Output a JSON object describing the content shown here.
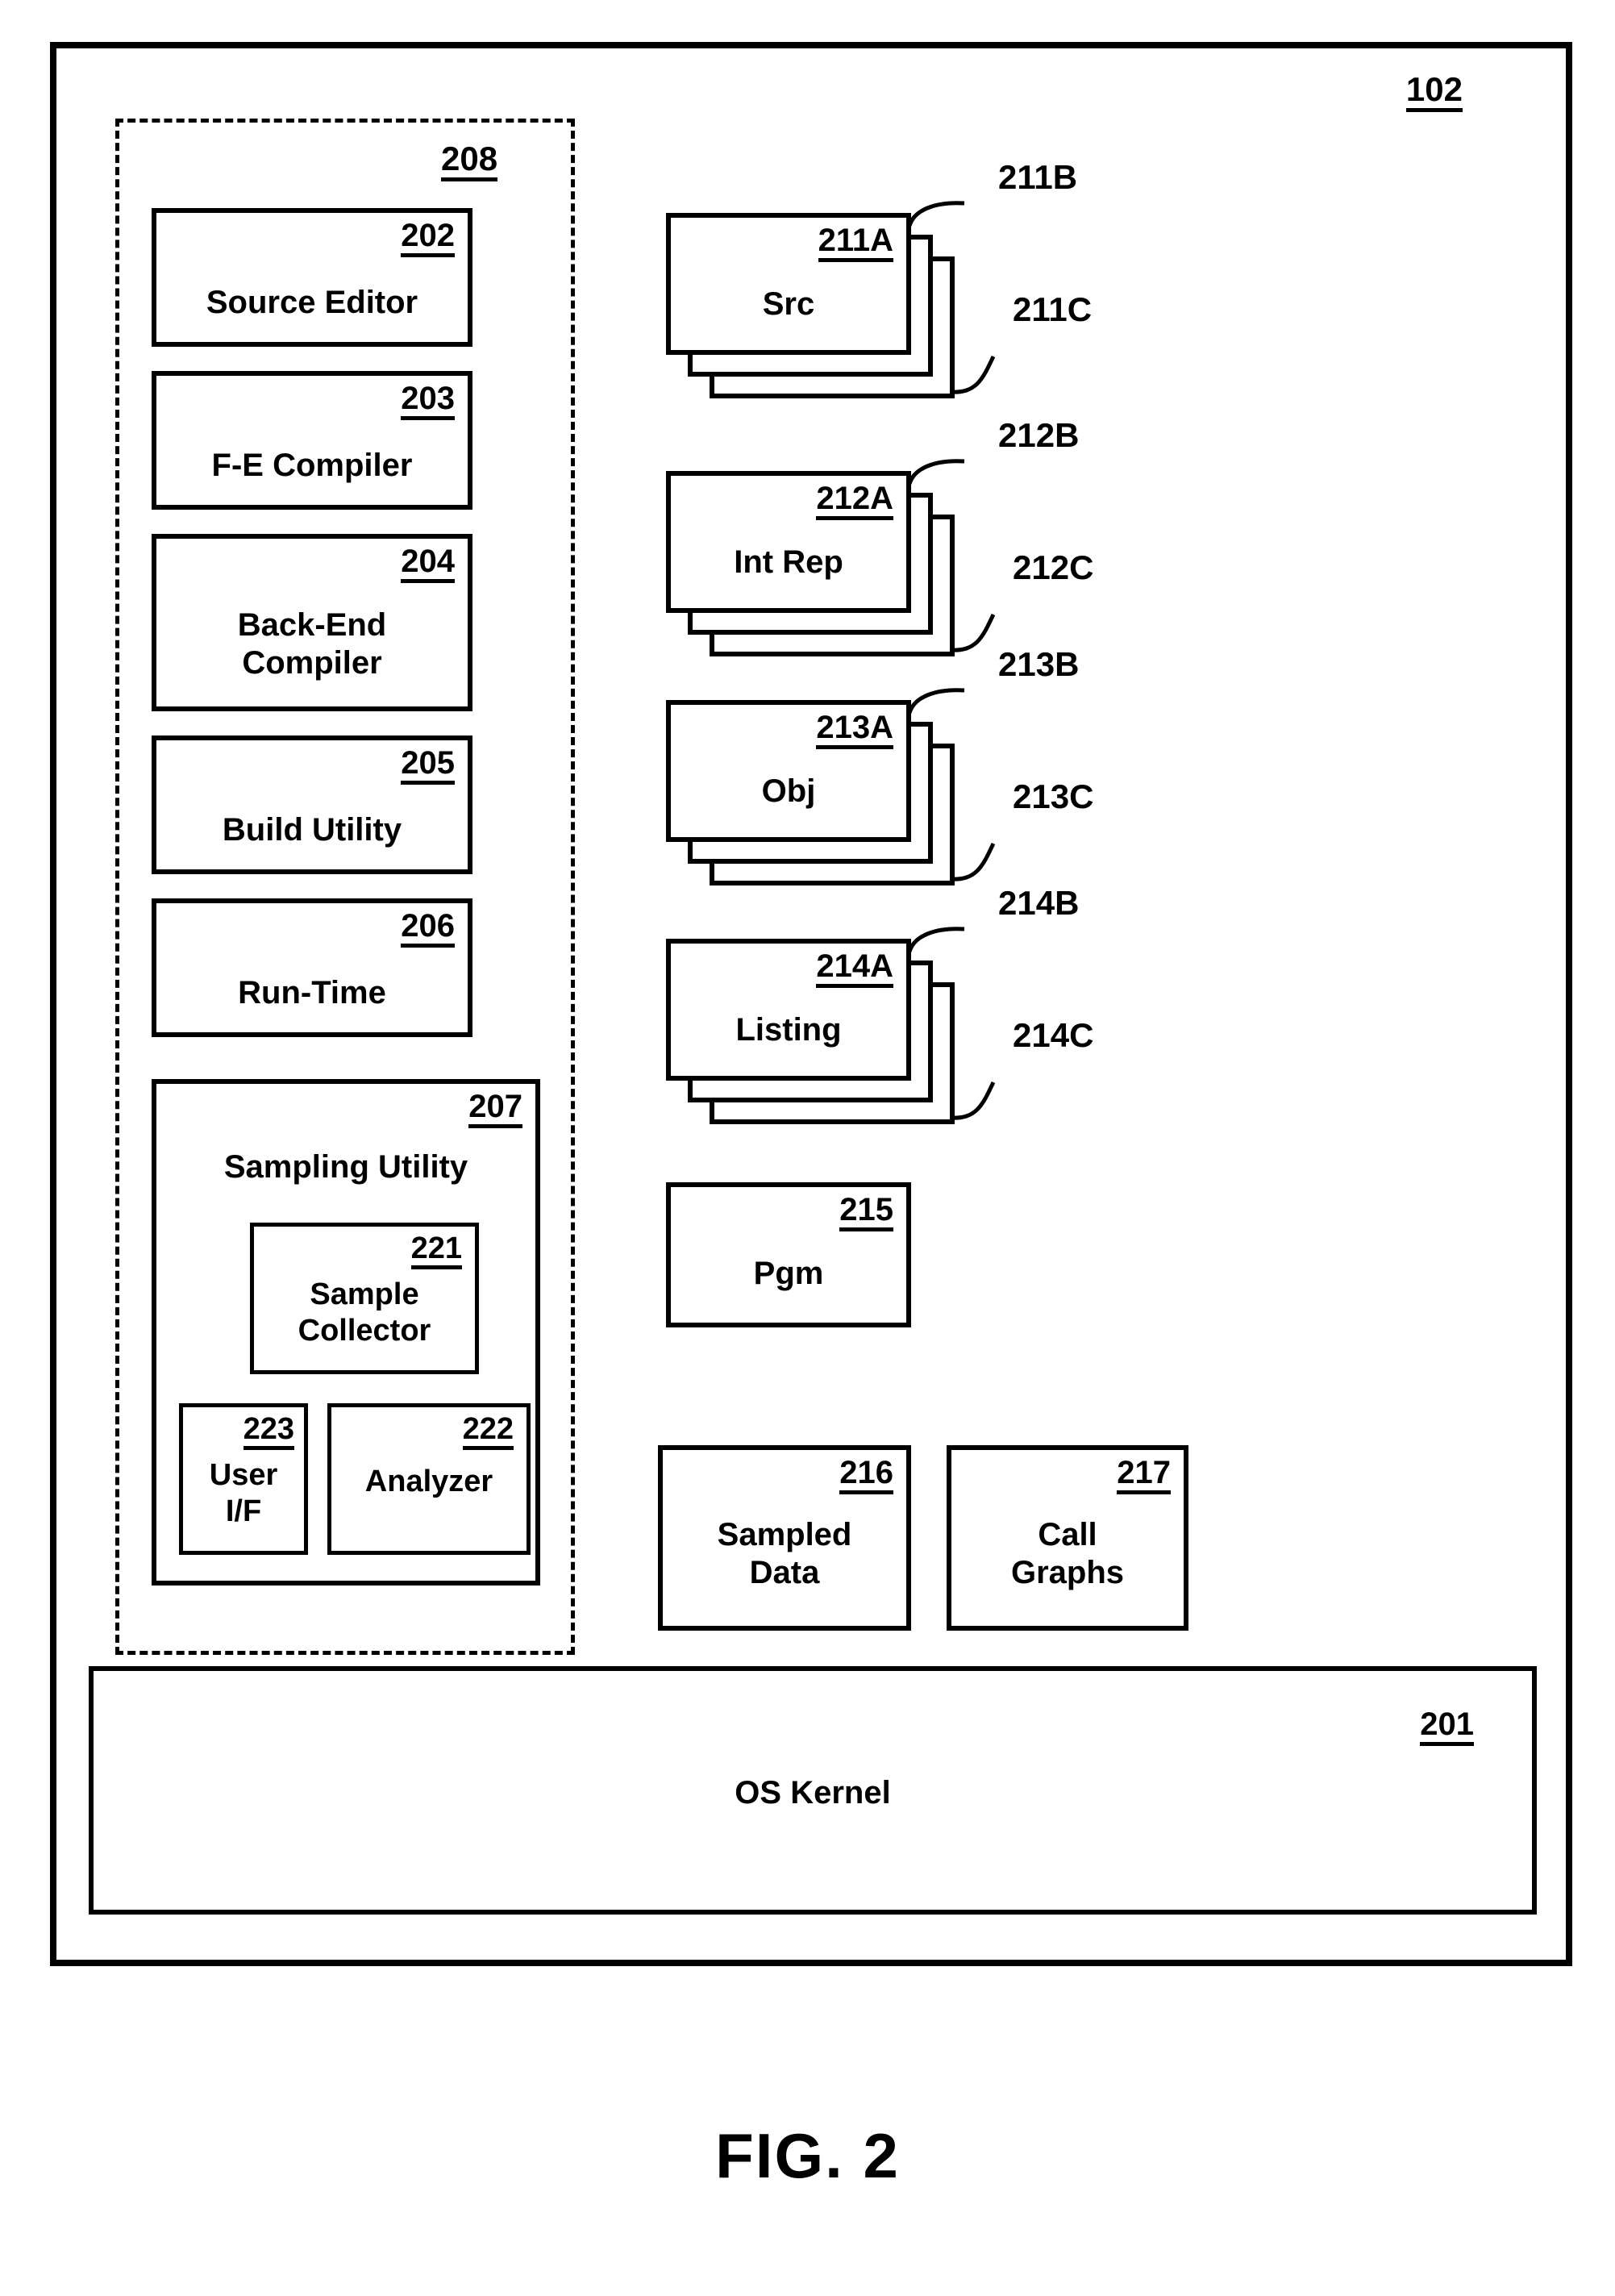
{
  "figure": {
    "caption": "FIG. 2",
    "system_numeral": "102"
  },
  "dashed_group": {
    "numeral": "208"
  },
  "left_column": {
    "items": [
      {
        "numeral": "202",
        "label": "Source Editor"
      },
      {
        "numeral": "203",
        "label": "F-E Compiler"
      },
      {
        "numeral": "204",
        "label": "Back-End\nCompiler"
      },
      {
        "numeral": "205",
        "label": "Build Utility"
      },
      {
        "numeral": "206",
        "label": "Run-Time"
      }
    ]
  },
  "sampling_utility": {
    "numeral": "207",
    "label": "Sampling Utility",
    "children": [
      {
        "numeral": "221",
        "label": "Sample\nCollector"
      },
      {
        "numeral": "223",
        "label": "User\nI/F"
      },
      {
        "numeral": "222",
        "label": "Analyzer"
      }
    ]
  },
  "artifact_stacks": [
    {
      "label": "Src",
      "numeral_a": "211A",
      "numeral_b": "211B",
      "numeral_c": "211C"
    },
    {
      "label": "Int Rep",
      "numeral_a": "212A",
      "numeral_b": "212B",
      "numeral_c": "212C"
    },
    {
      "label": "Obj",
      "numeral_a": "213A",
      "numeral_b": "213B",
      "numeral_c": "213C"
    },
    {
      "label": "Listing",
      "numeral_a": "214A",
      "numeral_b": "214B",
      "numeral_c": "214C"
    }
  ],
  "right_column_boxes": [
    {
      "numeral": "215",
      "label": "Pgm"
    },
    {
      "numeral": "216",
      "label": "Sampled\nData"
    },
    {
      "numeral": "217",
      "label": "Call\nGraphs"
    }
  ],
  "os_kernel": {
    "numeral": "201",
    "label": "OS Kernel"
  }
}
